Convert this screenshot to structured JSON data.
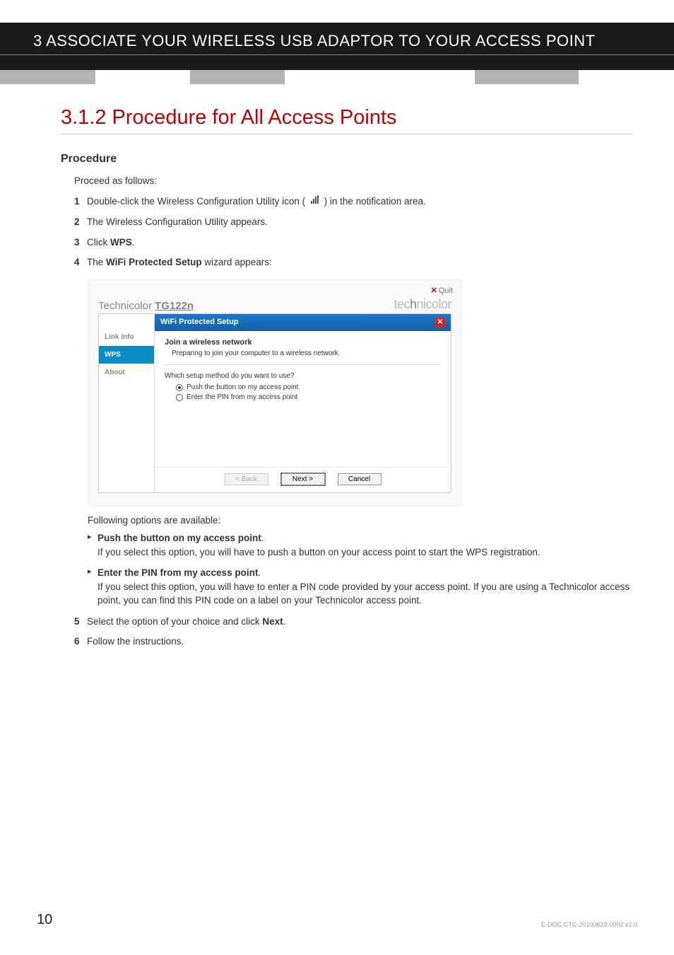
{
  "header": {
    "text": "3 ASSOCIATE YOUR WIRELESS USB ADAPTOR TO YOUR ACCESS POINT"
  },
  "section": {
    "title": "3.1.2  Procedure for All Access Points",
    "subtitle": "Procedure",
    "intro": "Proceed as follows:",
    "steps": [
      {
        "n": "1",
        "pre": "Double-click the Wireless Configuration Utility icon (",
        "post": ") in the notification area."
      },
      {
        "n": "2",
        "text": "The Wireless Configuration Utility appears."
      },
      {
        "n": "3",
        "pre": "Click ",
        "bold": "WPS",
        "post": "."
      },
      {
        "n": "4",
        "pre": "The ",
        "bold": "WiFi Protected Setup",
        "post": " wizard appears:"
      },
      {
        "n": "5",
        "pre": "Select the option of your choice and click ",
        "bold": "Next",
        "post": "."
      },
      {
        "n": "6",
        "text": "Follow the instructions."
      }
    ],
    "following": "Following options are available:",
    "options": [
      {
        "title": "Push the button on my access point",
        "desc": "If you select this option, you will have to push a button on your access point to start the WPS registration."
      },
      {
        "title": "Enter the PIN from my access point",
        "desc": "If you select this option, you will have to enter a PIN code provided by your access point. If you are using a Technicolor access point, you can find this PIN code on a label on your Technicolor access point."
      }
    ]
  },
  "app": {
    "quit": "Quit",
    "product": "Technicolor TG122n",
    "brand": "technicolor",
    "side": [
      "Link Info",
      "WPS",
      "About"
    ],
    "pane_title": "WiFi Protected Setup",
    "join_title": "Join a wireless network",
    "join_sub": "Preparing to join your computer to a wireless network.",
    "question": "Which setup method do you want to use?",
    "radio1": "Push the button on my access point",
    "radio2": "Enter the PIN from my access point",
    "btn_back": "< Back",
    "btn_next": "Next >",
    "btn_cancel": "Cancel"
  },
  "footer": {
    "page": "10",
    "doc": "E-DOC-CTC-20100623-0002 v2.0"
  }
}
